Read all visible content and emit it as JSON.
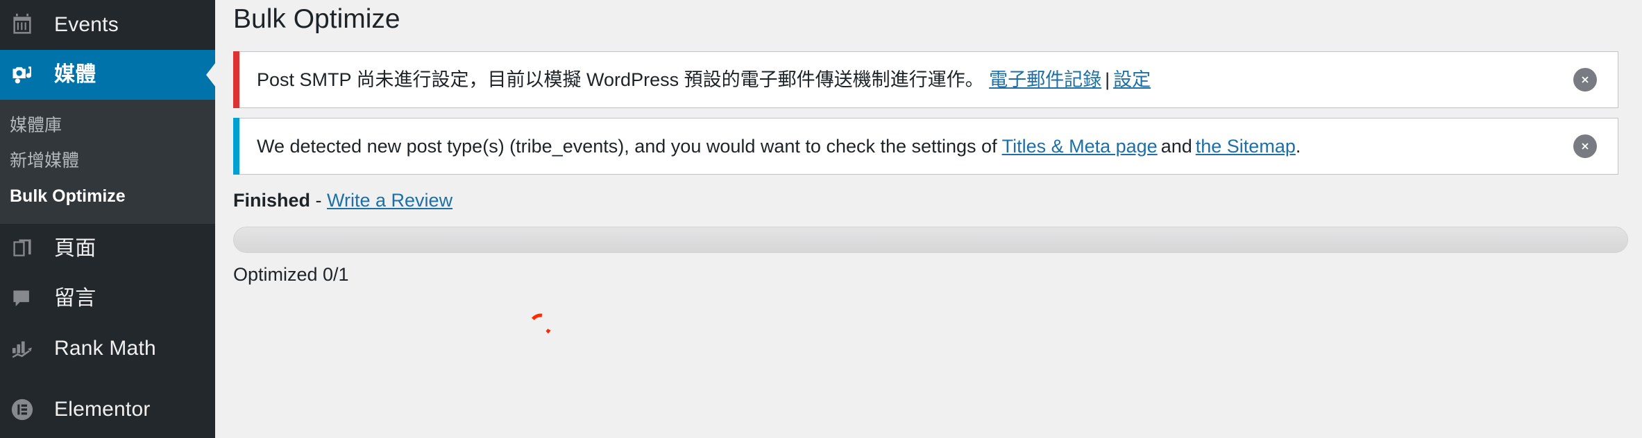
{
  "sidebar": {
    "items": [
      {
        "id": "events",
        "icon": "calendar-icon",
        "label": "Events",
        "current": false
      },
      {
        "id": "media",
        "icon": "media-icon",
        "label": "媒體",
        "current": true
      },
      {
        "id": "pages",
        "icon": "pages-icon",
        "label": "頁面",
        "current": false
      },
      {
        "id": "comments",
        "icon": "comment-icon",
        "label": "留言",
        "current": false
      },
      {
        "id": "rankmath",
        "icon": "rank-math-icon",
        "label": "Rank Math",
        "current": false
      },
      {
        "id": "elementor",
        "icon": "elementor-icon",
        "label": "Elementor",
        "current": false
      }
    ],
    "submenu": [
      {
        "id": "media-library",
        "label": "媒體庫",
        "active": false
      },
      {
        "id": "add-media",
        "label": "新增媒體",
        "active": false
      },
      {
        "id": "bulk-optimize",
        "label": "Bulk Optimize",
        "active": true
      }
    ]
  },
  "main": {
    "page_title": "Bulk Optimize",
    "notices": [
      {
        "id": "post-smtp-notice",
        "type": "error",
        "accent": "#dc3232",
        "text_before": "Post SMTP 尚未進行設定，目前以模擬 WordPress 預設的電子郵件傳送機制進行運作。 ",
        "link1": "電子郵件記錄",
        "separator": "|",
        "link2": "設定",
        "text_after": "",
        "dismiss_label": "dismiss-icon"
      },
      {
        "id": "rank-math-post-type-notice",
        "type": "info",
        "accent": "#00a0d2",
        "text_before": "We detected new post type(s) (tribe_events), and you would want to check the settings of ",
        "link1": "Titles & Meta page",
        "separator": "and",
        "link2": "the Sitemap",
        "text_after": ".",
        "dismiss_label": "dismiss-icon"
      }
    ],
    "status": {
      "state_label": "Finished",
      "dash": " - ",
      "review_link": "Write a Review"
    },
    "progress": {
      "percent": 0,
      "optimized_label": "Optimized 0/1"
    },
    "spinner": {
      "name": "loading-spinner",
      "color": "#ff2a00"
    }
  }
}
